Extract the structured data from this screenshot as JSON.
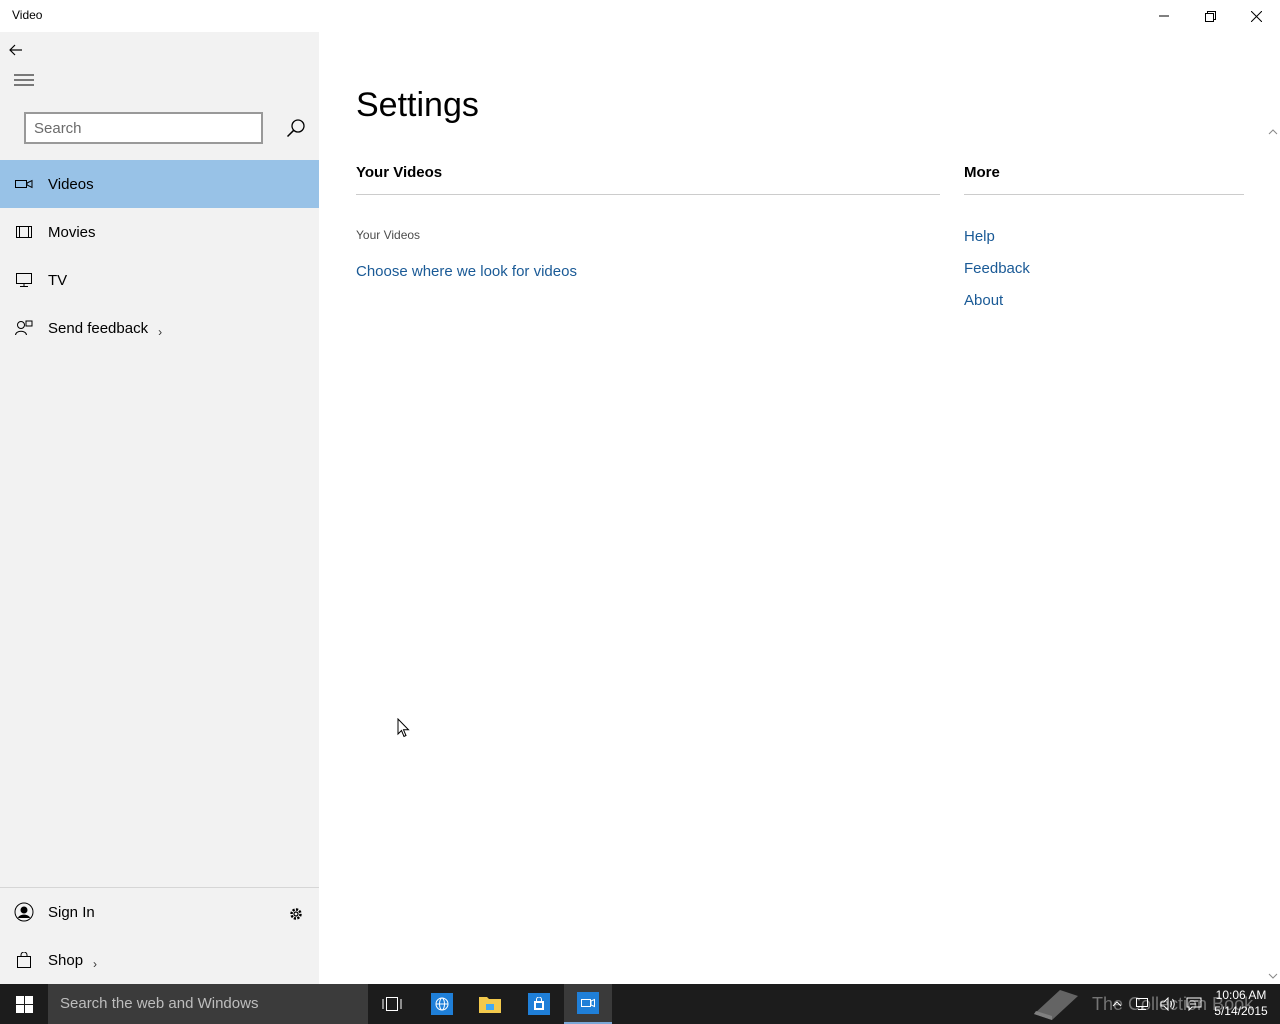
{
  "window": {
    "title": "Video"
  },
  "sidebar": {
    "search_placeholder": "Search",
    "items": [
      {
        "label": "Videos",
        "icon": "video-camera-icon",
        "selected": true
      },
      {
        "label": "Movies",
        "icon": "film-icon",
        "selected": false
      },
      {
        "label": "TV",
        "icon": "tv-icon",
        "selected": false
      },
      {
        "label": "Send feedback",
        "icon": "feedback-icon",
        "selected": false
      }
    ],
    "bottom": {
      "signin_label": "Sign In",
      "shop_label": "Shop"
    }
  },
  "main": {
    "page_title": "Settings",
    "your_videos": {
      "heading": "Your Videos",
      "sub_label": "Your Videos",
      "choose_link": "Choose where we look for videos"
    },
    "more": {
      "heading": "More",
      "links": [
        "Help",
        "Feedback",
        "About"
      ]
    }
  },
  "taskbar": {
    "search_placeholder": "Search the web and Windows",
    "watermark_text": "The Collection Book",
    "clock_time": "10:06 AM",
    "clock_date": "5/14/2015"
  },
  "colors": {
    "selected_nav": "#98c2e7",
    "link": "#1a5a96",
    "sidebar_bg": "#f2f2f2",
    "taskbar_bg": "#1c1c1c"
  }
}
